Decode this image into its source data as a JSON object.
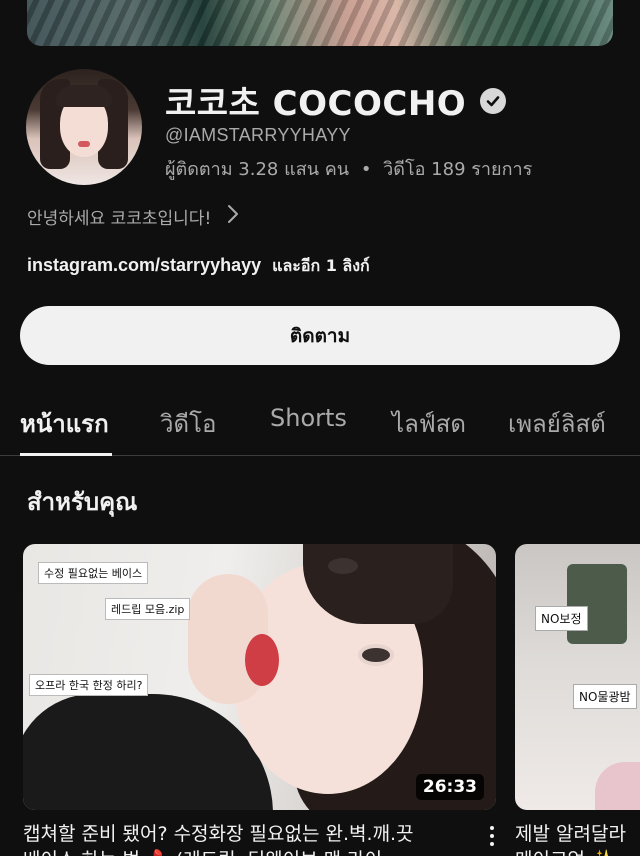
{
  "channel": {
    "name": "코코초 COCOCHO",
    "handle": "@IAMSTARRYYHAYY",
    "subscribers": "ผู้ติดตาม 3.28 แสน คน",
    "separator": "•",
    "videos": "วิดีโอ 189 รายการ",
    "description": "안녕하세요 코코초입니다!",
    "link": "instagram.com/starryyhayy",
    "more_links": "และอีก 1 ลิงก์",
    "subscribe_label": "ติดตาม"
  },
  "tabs": [
    {
      "label": "หน้าแรก",
      "active": true
    },
    {
      "label": "วิดีโอ"
    },
    {
      "label": "Shorts"
    },
    {
      "label": "ไลฟ์สด"
    },
    {
      "label": "เพลย์ลิสต์"
    }
  ],
  "section": {
    "title": "สำหรับคุณ"
  },
  "videos": [
    {
      "duration": "26:33",
      "title_line1": "캡쳐할 준비 됐어? 수정화장 필요없는 완.벽.깨.끗",
      "title_line2": "베이스 하는 법 💄 (레드립, 딥웨이브 맨 라이",
      "thumb_labels": [
        "수정 필요없는 베이스",
        "레드립 모음.zip",
        "오프라 한국 한정 하리?"
      ]
    },
    {
      "title_line1": "제발 알려달라",
      "title_line2": "메이크업 ✨",
      "thumb_labels": [
        "NO보정",
        "NO물광밤"
      ]
    }
  ],
  "colors": {
    "background": "#0f0f0f",
    "text": "#f1f1f1",
    "secondary": "#aaaaaa",
    "button": "#f1f1f1"
  }
}
